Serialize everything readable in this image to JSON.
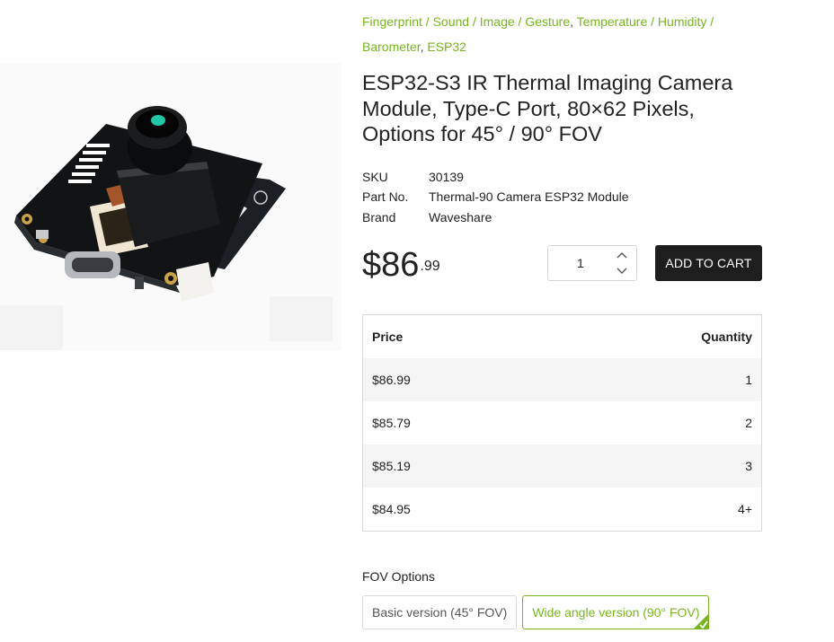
{
  "breadcrumb": {
    "cat1": "Fingerprint / Sound / Image / Gesture",
    "cat2": "Temperature / Humidity / Barometer",
    "cat3": "ESP32",
    "separator": ","
  },
  "product": {
    "title": "ESP32-S3 IR Thermal Imaging Camera Module, Type-C Port, 80×62 Pixels, Options for 45° / 90° FOV",
    "image_icon": "thermal-camera-module-photo"
  },
  "specs": [
    {
      "label": "SKU",
      "value": "30139"
    },
    {
      "label": "Part No.",
      "value": "Thermal-90 Camera ESP32 Module"
    },
    {
      "label": "Brand",
      "value": "Waveshare"
    }
  ],
  "price": {
    "main": "$86",
    "cents": ".99"
  },
  "quantity": {
    "value": "1"
  },
  "cart": {
    "label": "ADD TO CART"
  },
  "tiers": {
    "header": {
      "price": "Price",
      "quantity": "Quantity"
    },
    "rows": [
      {
        "price": "$86.99",
        "qty": "1"
      },
      {
        "price": "$85.79",
        "qty": "2"
      },
      {
        "price": "$85.19",
        "qty": "3"
      },
      {
        "price": "$84.95",
        "qty": "4+"
      }
    ]
  },
  "fov": {
    "label": "FOV Options",
    "options": [
      {
        "label": "Basic version (45° FOV)",
        "selected": false
      },
      {
        "label": "Wide angle version (90° FOV)",
        "selected": true
      }
    ]
  },
  "colors": {
    "accent": "#78b51e",
    "button": "#1e1e1e",
    "text": "#222222"
  }
}
